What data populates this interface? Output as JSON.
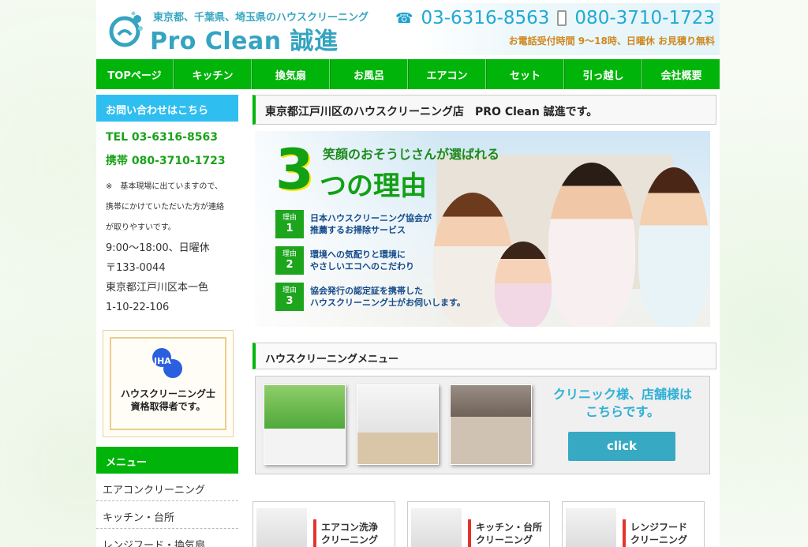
{
  "header": {
    "tagline": "東京都、千葉県、埼玉県のハウスクリーニング",
    "brand": "Pro Clean 誠進",
    "phone": "03-6316-8563",
    "mobile": "080-3710-1723",
    "hours": "お電話受付時間 9～18時、日曜休 お見積り無料"
  },
  "nav": [
    "TOPページ",
    "キッチン",
    "換気扇",
    "お風呂",
    "エアコン",
    "セット",
    "引っ越し",
    "会社概要"
  ],
  "sidebar": {
    "contact_heading": "お問い合わせはこちら",
    "tel": "TEL 03-6316-8563",
    "mobile": "携帯 080-3710-1723",
    "note_lines": [
      "※　基本現場に出ていますので、",
      "携帯にかけていただいた方が連絡",
      "が取りやすいです。"
    ],
    "hours": "9:00～18:00、日曜休",
    "postal": "〒133-0044",
    "address1": "東京都江戸川区本一色",
    "address2": "1-10-22-106",
    "jha_logo": "JHA",
    "jha_line1": "ハウスクリーニング士",
    "jha_line2": "資格取得者です。",
    "menu_heading": "メニュー",
    "menu_items": [
      "エアコンクリーニング",
      "キッチン・台所",
      "レンジフード・換気扇"
    ]
  },
  "main": {
    "title": "東京都江戸川区のハウスクリーニング店　PRO Clean 誠進です。",
    "hero": {
      "big_number": "3",
      "subtitle": "笑顔のおそうじさんが選ばれる",
      "headline": "つの理由",
      "badge_label": "理由",
      "reasons": [
        {
          "n": "1",
          "line1": "日本ハウスクリーニング協会が",
          "line2": "推薦するお掃除サービス"
        },
        {
          "n": "2",
          "line1": "環境への気配りと環境に",
          "line2": "やさしいエコへのこだわり"
        },
        {
          "n": "3",
          "line1": "協会発行の認定証を携帯した",
          "line2": "ハウスクリーニング士がお伺いします。"
        }
      ]
    },
    "menu_title": "ハウスクリーニングメニュー",
    "clinic_line1": "クリニック様、店舗様は",
    "clinic_line2": "こちらです。",
    "click_label": "click",
    "services": [
      {
        "line1": "エアコン洗浄",
        "line2": "クリーニング"
      },
      {
        "line1": "キッチン・台所",
        "line2": "クリーニング"
      },
      {
        "line1": "レンジフード",
        "line2": "クリーニング"
      }
    ]
  }
}
